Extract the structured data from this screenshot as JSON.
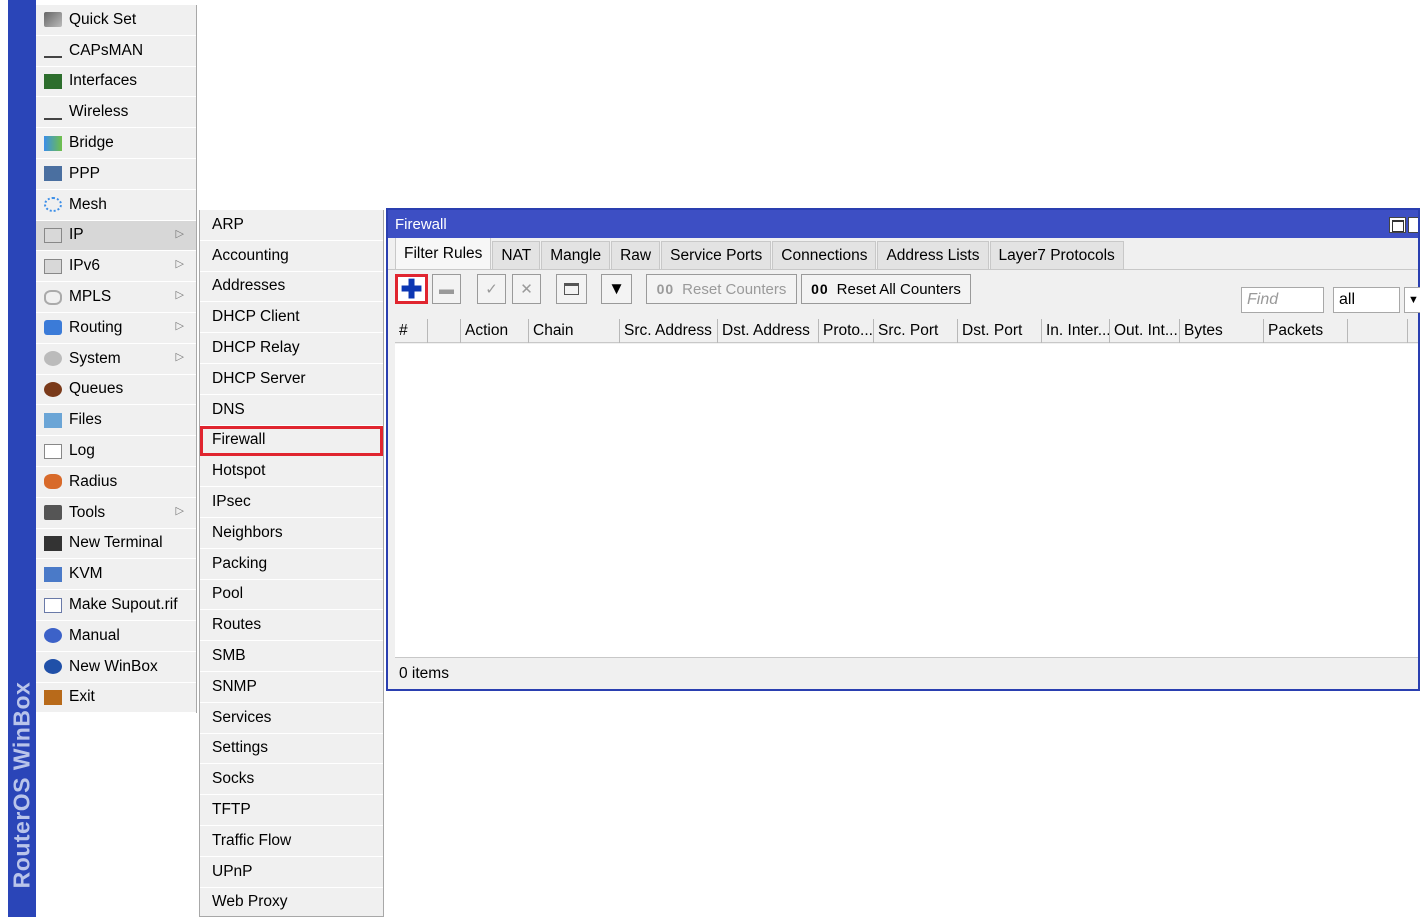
{
  "brand": {
    "vertical_text": "RouterOS WinBox"
  },
  "main_menu": [
    {
      "label": "Quick Set",
      "icon": "quick-set-icon",
      "arrow": false
    },
    {
      "label": "CAPsMAN",
      "icon": "antenna-icon",
      "arrow": false
    },
    {
      "label": "Interfaces",
      "icon": "interfaces-icon",
      "arrow": false
    },
    {
      "label": "Wireless",
      "icon": "antenna-icon",
      "arrow": false
    },
    {
      "label": "Bridge",
      "icon": "bridge-icon",
      "arrow": false
    },
    {
      "label": "PPP",
      "icon": "ppp-icon",
      "arrow": false
    },
    {
      "label": "Mesh",
      "icon": "mesh-icon",
      "arrow": false
    },
    {
      "label": "IP",
      "icon": "ip-icon",
      "arrow": true
    },
    {
      "label": "IPv6",
      "icon": "ipv6-icon",
      "arrow": true
    },
    {
      "label": "MPLS",
      "icon": "mpls-icon",
      "arrow": true
    },
    {
      "label": "Routing",
      "icon": "routing-icon",
      "arrow": true
    },
    {
      "label": "System",
      "icon": "gear-icon",
      "arrow": true
    },
    {
      "label": "Queues",
      "icon": "queues-icon",
      "arrow": false
    },
    {
      "label": "Files",
      "icon": "folder-icon",
      "arrow": false
    },
    {
      "label": "Log",
      "icon": "log-icon",
      "arrow": false
    },
    {
      "label": "Radius",
      "icon": "users-icon",
      "arrow": false
    },
    {
      "label": "Tools",
      "icon": "tools-icon",
      "arrow": true
    },
    {
      "label": "New Terminal",
      "icon": "terminal-icon",
      "arrow": false
    },
    {
      "label": "KVM",
      "icon": "kvm-icon",
      "arrow": false
    },
    {
      "label": "Make Supout.rif",
      "icon": "document-icon",
      "arrow": false
    },
    {
      "label": "Manual",
      "icon": "help-icon",
      "arrow": false
    },
    {
      "label": "New WinBox",
      "icon": "winbox-icon",
      "arrow": false
    },
    {
      "label": "Exit",
      "icon": "exit-icon",
      "arrow": false
    }
  ],
  "ip_submenu": [
    "ARP",
    "Accounting",
    "Addresses",
    "DHCP Client",
    "DHCP Relay",
    "DHCP Server",
    "DNS",
    "Firewall",
    "Hotspot",
    "IPsec",
    "Neighbors",
    "Packing",
    "Pool",
    "Routes",
    "SMB",
    "SNMP",
    "Services",
    "Settings",
    "Socks",
    "TFTP",
    "Traffic Flow",
    "UPnP",
    "Web Proxy"
  ],
  "firewall": {
    "title": "Firewall",
    "tabs": [
      "Filter Rules",
      "NAT",
      "Mangle",
      "Raw",
      "Service Ports",
      "Connections",
      "Address Lists",
      "Layer7 Protocols"
    ],
    "toolbar": {
      "reset_counters": "Reset Counters",
      "reset_all_counters": "Reset All Counters",
      "oo": "00",
      "find_placeholder": "Find",
      "filter_value": "all"
    },
    "columns": [
      "#",
      "",
      "Action",
      "Chain",
      "Src. Address",
      "Dst. Address",
      "Proto...",
      "Src. Port",
      "Dst. Port",
      "In. Inter...",
      "Out. Int...",
      "Bytes",
      "Packets",
      ""
    ],
    "status": "0 items"
  },
  "colors": {
    "accent": "#3d4fc4",
    "highlight": "#e0252f",
    "plus": "#0c37b3"
  }
}
